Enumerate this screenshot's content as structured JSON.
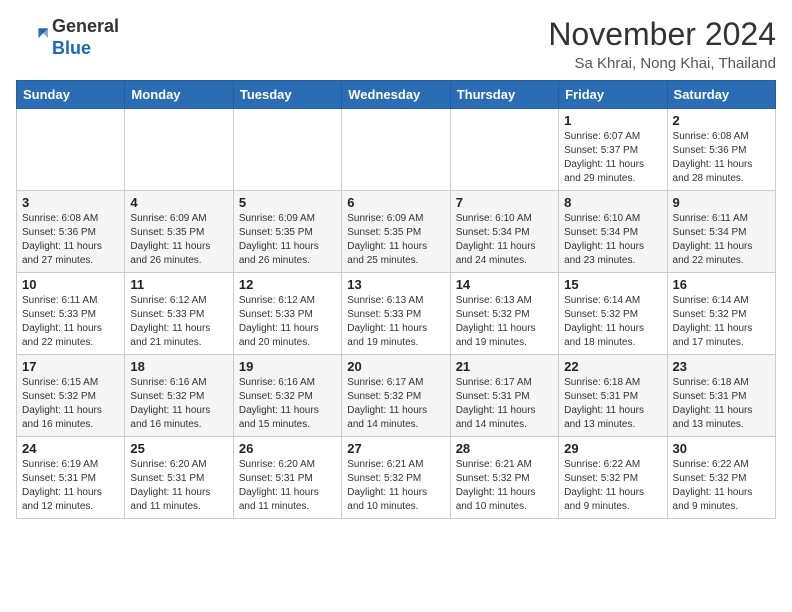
{
  "header": {
    "logo_line1": "General",
    "logo_line2": "Blue",
    "month": "November 2024",
    "location": "Sa Khrai, Nong Khai, Thailand"
  },
  "weekdays": [
    "Sunday",
    "Monday",
    "Tuesday",
    "Wednesday",
    "Thursday",
    "Friday",
    "Saturday"
  ],
  "weeks": [
    [
      {
        "day": "",
        "info": ""
      },
      {
        "day": "",
        "info": ""
      },
      {
        "day": "",
        "info": ""
      },
      {
        "day": "",
        "info": ""
      },
      {
        "day": "",
        "info": ""
      },
      {
        "day": "1",
        "info": "Sunrise: 6:07 AM\nSunset: 5:37 PM\nDaylight: 11 hours\nand 29 minutes."
      },
      {
        "day": "2",
        "info": "Sunrise: 6:08 AM\nSunset: 5:36 PM\nDaylight: 11 hours\nand 28 minutes."
      }
    ],
    [
      {
        "day": "3",
        "info": "Sunrise: 6:08 AM\nSunset: 5:36 PM\nDaylight: 11 hours\nand 27 minutes."
      },
      {
        "day": "4",
        "info": "Sunrise: 6:09 AM\nSunset: 5:35 PM\nDaylight: 11 hours\nand 26 minutes."
      },
      {
        "day": "5",
        "info": "Sunrise: 6:09 AM\nSunset: 5:35 PM\nDaylight: 11 hours\nand 26 minutes."
      },
      {
        "day": "6",
        "info": "Sunrise: 6:09 AM\nSunset: 5:35 PM\nDaylight: 11 hours\nand 25 minutes."
      },
      {
        "day": "7",
        "info": "Sunrise: 6:10 AM\nSunset: 5:34 PM\nDaylight: 11 hours\nand 24 minutes."
      },
      {
        "day": "8",
        "info": "Sunrise: 6:10 AM\nSunset: 5:34 PM\nDaylight: 11 hours\nand 23 minutes."
      },
      {
        "day": "9",
        "info": "Sunrise: 6:11 AM\nSunset: 5:34 PM\nDaylight: 11 hours\nand 22 minutes."
      }
    ],
    [
      {
        "day": "10",
        "info": "Sunrise: 6:11 AM\nSunset: 5:33 PM\nDaylight: 11 hours\nand 22 minutes."
      },
      {
        "day": "11",
        "info": "Sunrise: 6:12 AM\nSunset: 5:33 PM\nDaylight: 11 hours\nand 21 minutes."
      },
      {
        "day": "12",
        "info": "Sunrise: 6:12 AM\nSunset: 5:33 PM\nDaylight: 11 hours\nand 20 minutes."
      },
      {
        "day": "13",
        "info": "Sunrise: 6:13 AM\nSunset: 5:33 PM\nDaylight: 11 hours\nand 19 minutes."
      },
      {
        "day": "14",
        "info": "Sunrise: 6:13 AM\nSunset: 5:32 PM\nDaylight: 11 hours\nand 19 minutes."
      },
      {
        "day": "15",
        "info": "Sunrise: 6:14 AM\nSunset: 5:32 PM\nDaylight: 11 hours\nand 18 minutes."
      },
      {
        "day": "16",
        "info": "Sunrise: 6:14 AM\nSunset: 5:32 PM\nDaylight: 11 hours\nand 17 minutes."
      }
    ],
    [
      {
        "day": "17",
        "info": "Sunrise: 6:15 AM\nSunset: 5:32 PM\nDaylight: 11 hours\nand 16 minutes."
      },
      {
        "day": "18",
        "info": "Sunrise: 6:16 AM\nSunset: 5:32 PM\nDaylight: 11 hours\nand 16 minutes."
      },
      {
        "day": "19",
        "info": "Sunrise: 6:16 AM\nSunset: 5:32 PM\nDaylight: 11 hours\nand 15 minutes."
      },
      {
        "day": "20",
        "info": "Sunrise: 6:17 AM\nSunset: 5:32 PM\nDaylight: 11 hours\nand 14 minutes."
      },
      {
        "day": "21",
        "info": "Sunrise: 6:17 AM\nSunset: 5:31 PM\nDaylight: 11 hours\nand 14 minutes."
      },
      {
        "day": "22",
        "info": "Sunrise: 6:18 AM\nSunset: 5:31 PM\nDaylight: 11 hours\nand 13 minutes."
      },
      {
        "day": "23",
        "info": "Sunrise: 6:18 AM\nSunset: 5:31 PM\nDaylight: 11 hours\nand 13 minutes."
      }
    ],
    [
      {
        "day": "24",
        "info": "Sunrise: 6:19 AM\nSunset: 5:31 PM\nDaylight: 11 hours\nand 12 minutes."
      },
      {
        "day": "25",
        "info": "Sunrise: 6:20 AM\nSunset: 5:31 PM\nDaylight: 11 hours\nand 11 minutes."
      },
      {
        "day": "26",
        "info": "Sunrise: 6:20 AM\nSunset: 5:31 PM\nDaylight: 11 hours\nand 11 minutes."
      },
      {
        "day": "27",
        "info": "Sunrise: 6:21 AM\nSunset: 5:32 PM\nDaylight: 11 hours\nand 10 minutes."
      },
      {
        "day": "28",
        "info": "Sunrise: 6:21 AM\nSunset: 5:32 PM\nDaylight: 11 hours\nand 10 minutes."
      },
      {
        "day": "29",
        "info": "Sunrise: 6:22 AM\nSunset: 5:32 PM\nDaylight: 11 hours\nand 9 minutes."
      },
      {
        "day": "30",
        "info": "Sunrise: 6:22 AM\nSunset: 5:32 PM\nDaylight: 11 hours\nand 9 minutes."
      }
    ]
  ]
}
